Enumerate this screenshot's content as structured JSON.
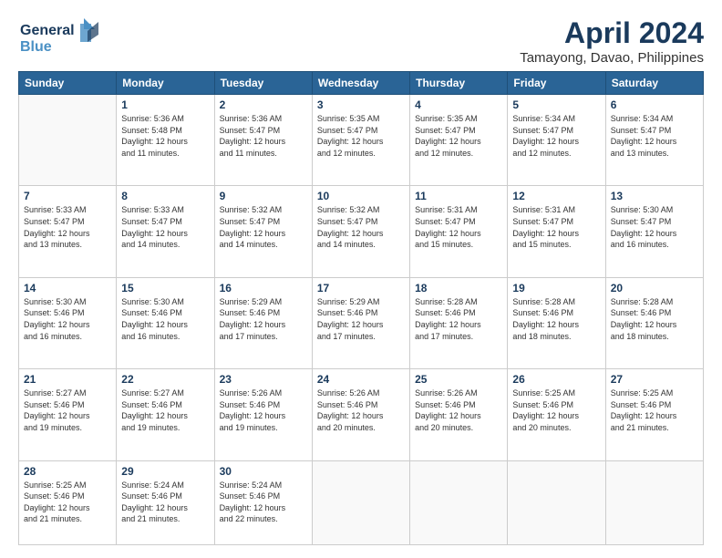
{
  "logo": {
    "line1": "General",
    "line2": "Blue",
    "accent": "Blue"
  },
  "title": "April 2024",
  "subtitle": "Tamayong, Davao, Philippines",
  "headers": [
    "Sunday",
    "Monday",
    "Tuesday",
    "Wednesday",
    "Thursday",
    "Friday",
    "Saturday"
  ],
  "weeks": [
    [
      {
        "day": "",
        "info": ""
      },
      {
        "day": "1",
        "info": "Sunrise: 5:36 AM\nSunset: 5:48 PM\nDaylight: 12 hours\nand 11 minutes."
      },
      {
        "day": "2",
        "info": "Sunrise: 5:36 AM\nSunset: 5:47 PM\nDaylight: 12 hours\nand 11 minutes."
      },
      {
        "day": "3",
        "info": "Sunrise: 5:35 AM\nSunset: 5:47 PM\nDaylight: 12 hours\nand 12 minutes."
      },
      {
        "day": "4",
        "info": "Sunrise: 5:35 AM\nSunset: 5:47 PM\nDaylight: 12 hours\nand 12 minutes."
      },
      {
        "day": "5",
        "info": "Sunrise: 5:34 AM\nSunset: 5:47 PM\nDaylight: 12 hours\nand 12 minutes."
      },
      {
        "day": "6",
        "info": "Sunrise: 5:34 AM\nSunset: 5:47 PM\nDaylight: 12 hours\nand 13 minutes."
      }
    ],
    [
      {
        "day": "7",
        "info": "Sunrise: 5:33 AM\nSunset: 5:47 PM\nDaylight: 12 hours\nand 13 minutes."
      },
      {
        "day": "8",
        "info": "Sunrise: 5:33 AM\nSunset: 5:47 PM\nDaylight: 12 hours\nand 14 minutes."
      },
      {
        "day": "9",
        "info": "Sunrise: 5:32 AM\nSunset: 5:47 PM\nDaylight: 12 hours\nand 14 minutes."
      },
      {
        "day": "10",
        "info": "Sunrise: 5:32 AM\nSunset: 5:47 PM\nDaylight: 12 hours\nand 14 minutes."
      },
      {
        "day": "11",
        "info": "Sunrise: 5:31 AM\nSunset: 5:47 PM\nDaylight: 12 hours\nand 15 minutes."
      },
      {
        "day": "12",
        "info": "Sunrise: 5:31 AM\nSunset: 5:47 PM\nDaylight: 12 hours\nand 15 minutes."
      },
      {
        "day": "13",
        "info": "Sunrise: 5:30 AM\nSunset: 5:47 PM\nDaylight: 12 hours\nand 16 minutes."
      }
    ],
    [
      {
        "day": "14",
        "info": "Sunrise: 5:30 AM\nSunset: 5:46 PM\nDaylight: 12 hours\nand 16 minutes."
      },
      {
        "day": "15",
        "info": "Sunrise: 5:30 AM\nSunset: 5:46 PM\nDaylight: 12 hours\nand 16 minutes."
      },
      {
        "day": "16",
        "info": "Sunrise: 5:29 AM\nSunset: 5:46 PM\nDaylight: 12 hours\nand 17 minutes."
      },
      {
        "day": "17",
        "info": "Sunrise: 5:29 AM\nSunset: 5:46 PM\nDaylight: 12 hours\nand 17 minutes."
      },
      {
        "day": "18",
        "info": "Sunrise: 5:28 AM\nSunset: 5:46 PM\nDaylight: 12 hours\nand 17 minutes."
      },
      {
        "day": "19",
        "info": "Sunrise: 5:28 AM\nSunset: 5:46 PM\nDaylight: 12 hours\nand 18 minutes."
      },
      {
        "day": "20",
        "info": "Sunrise: 5:28 AM\nSunset: 5:46 PM\nDaylight: 12 hours\nand 18 minutes."
      }
    ],
    [
      {
        "day": "21",
        "info": "Sunrise: 5:27 AM\nSunset: 5:46 PM\nDaylight: 12 hours\nand 19 minutes."
      },
      {
        "day": "22",
        "info": "Sunrise: 5:27 AM\nSunset: 5:46 PM\nDaylight: 12 hours\nand 19 minutes."
      },
      {
        "day": "23",
        "info": "Sunrise: 5:26 AM\nSunset: 5:46 PM\nDaylight: 12 hours\nand 19 minutes."
      },
      {
        "day": "24",
        "info": "Sunrise: 5:26 AM\nSunset: 5:46 PM\nDaylight: 12 hours\nand 20 minutes."
      },
      {
        "day": "25",
        "info": "Sunrise: 5:26 AM\nSunset: 5:46 PM\nDaylight: 12 hours\nand 20 minutes."
      },
      {
        "day": "26",
        "info": "Sunrise: 5:25 AM\nSunset: 5:46 PM\nDaylight: 12 hours\nand 20 minutes."
      },
      {
        "day": "27",
        "info": "Sunrise: 5:25 AM\nSunset: 5:46 PM\nDaylight: 12 hours\nand 21 minutes."
      }
    ],
    [
      {
        "day": "28",
        "info": "Sunrise: 5:25 AM\nSunset: 5:46 PM\nDaylight: 12 hours\nand 21 minutes."
      },
      {
        "day": "29",
        "info": "Sunrise: 5:24 AM\nSunset: 5:46 PM\nDaylight: 12 hours\nand 21 minutes."
      },
      {
        "day": "30",
        "info": "Sunrise: 5:24 AM\nSunset: 5:46 PM\nDaylight: 12 hours\nand 22 minutes."
      },
      {
        "day": "",
        "info": ""
      },
      {
        "day": "",
        "info": ""
      },
      {
        "day": "",
        "info": ""
      },
      {
        "day": "",
        "info": ""
      }
    ]
  ]
}
